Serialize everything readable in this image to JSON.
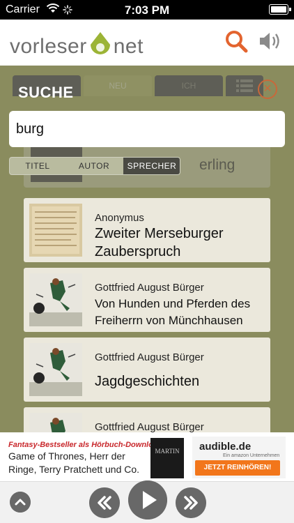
{
  "status_bar": {
    "carrier": "Carrier",
    "time": "7:03 PM"
  },
  "header": {
    "logo_left": "vorleser",
    "logo_right": "net",
    "search_icon": "search-icon",
    "speaker_icon": "speaker-icon",
    "accent_color": "#e3642f"
  },
  "tabs": [
    {
      "label": "",
      "active": false
    },
    {
      "label": "NEU",
      "active": true
    },
    {
      "label": "ICH",
      "active": false
    },
    {
      "label": "",
      "icon": "list-icon"
    }
  ],
  "search": {
    "heading": "SUCHE",
    "value": "burg",
    "filters": [
      {
        "label": "TITEL",
        "selected": false
      },
      {
        "label": "AUTOR",
        "selected": false
      },
      {
        "label": "SPRECHER",
        "selected": true
      }
    ]
  },
  "background_item": {
    "title_fragment": "erling"
  },
  "results": [
    {
      "author": "Anonymus",
      "title": "Zweiter Merseburger Zauberspruch"
    },
    {
      "author": "Gottfried August Bürger",
      "title": "Von Hunden und Pferden des Freiherrn von Münchhausen"
    },
    {
      "author": "Gottfried August Bürger",
      "title": "Jagdgeschichten"
    },
    {
      "author": "Gottfried August Bürger",
      "title": ""
    }
  ],
  "ad": {
    "tagline": "Fantasy-Bestseller als Hörbuch-Downloads",
    "text": "Game of Thrones, Herr der Ringe, Terry Pratchett und Co.",
    "cover_text": "MARTIN",
    "brand": "audible.de",
    "brand_sub": "Ein amazon Unternehmen",
    "cta": "JETZT REINHÖREN!",
    "cta_color": "#f2761b"
  },
  "player": {
    "icons": [
      "chevron-up-icon",
      "rewind-icon",
      "play-icon",
      "fast-forward-icon"
    ]
  }
}
